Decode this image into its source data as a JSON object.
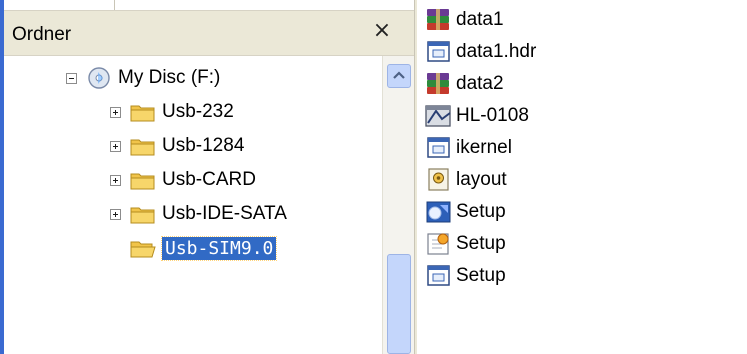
{
  "folder_pane": {
    "title": "Ordner",
    "close_glyph": "×",
    "close_icon": "close-icon",
    "tree": [
      {
        "label": "My Disc (F:)",
        "icon": "cd-drive-icon",
        "expander": "minus",
        "selected": false
      },
      {
        "label": "Usb-232",
        "icon": "folder-icon",
        "expander": "plus",
        "selected": false
      },
      {
        "label": "Usb-1284",
        "icon": "folder-icon",
        "expander": "plus",
        "selected": false
      },
      {
        "label": "Usb-CARD",
        "icon": "folder-icon",
        "expander": "plus",
        "selected": false
      },
      {
        "label": "Usb-IDE-SATA",
        "icon": "folder-icon",
        "expander": "plus",
        "selected": false
      },
      {
        "label": "Usb-SIM9.0",
        "icon": "folder-icon",
        "expander": "none",
        "selected": true
      }
    ]
  },
  "file_list": [
    {
      "label": "data1",
      "icon": "winrar-archive-icon"
    },
    {
      "label": "data1.hdr",
      "icon": "window-file-icon"
    },
    {
      "label": "data2",
      "icon": "winrar-archive-icon"
    },
    {
      "label": "HL-0108",
      "icon": "installer-disc-icon"
    },
    {
      "label": "ikernel",
      "icon": "window-file-icon"
    },
    {
      "label": "layout",
      "icon": "config-settings-icon"
    },
    {
      "label": "Setup",
      "icon": "setup-exe-icon"
    },
    {
      "label": "Setup",
      "icon": "setup-ini-icon"
    },
    {
      "label": "Setup",
      "icon": "window-file-icon"
    }
  ],
  "colors": {
    "header_bg": "#ebe8d7",
    "selection": "#316ac5",
    "folder_yellow": "#f7d66a",
    "scroll_blue": "#c4d6fb",
    "left_edge": "#3a6ad1"
  }
}
